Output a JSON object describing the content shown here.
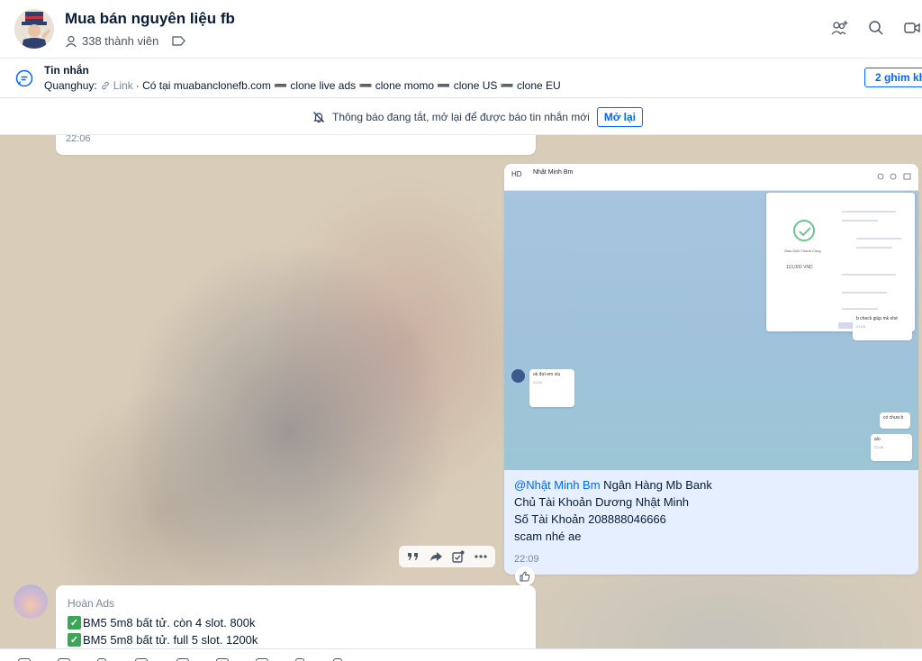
{
  "header": {
    "title": "Mua bán nguyên liệu fb",
    "members": "338 thành viên"
  },
  "pinned": {
    "title": "Tin nhắn",
    "sender": "Quanghuy:",
    "link_label": "Link",
    "text": "· Có tại muabanclonefb.com ➖ clone live ads ➖ clone momo ➖ clone US ➖ clone EU",
    "pins_button": "2 ghim khác"
  },
  "notification": {
    "text": "Thông báo đang tắt, mở lại để được báo tin nhắn mới",
    "reopen_label": "Mở lại"
  },
  "messages": {
    "previous_time": "22:06",
    "card": {
      "screenshot": {
        "initials": "HD",
        "name": "Nhật Minh Bm",
        "receipt_title": "Giao Dịch Thành Công",
        "receipt_amount": "110,000 VND",
        "msg1": "b check giúp mk nhé",
        "msg1_time": "21:03",
        "msg2": "ok đợi em xíu",
        "msg2_time": "21:04",
        "msg3": "có chưa b",
        "msg4": "alo",
        "msg4_time": "22:08"
      },
      "mention": "@Nhật Minh Bm",
      "line1_rest": " Ngân Hàng Mb Bank",
      "line2": "Chủ Tài Khoản Dương Nhật Minh",
      "line3": "Số Tài Khoản 208888046666",
      "line4": "scam nhé ae",
      "time": "22:09"
    },
    "hoan": {
      "sender": "Hoàn Ads",
      "line1": "BM5 5m8 bất tử. còn 4 slot. 800k",
      "line2": "BM5 5m8 bất tử. full 5 slot. 1200k"
    }
  },
  "colors": {
    "accent": "#0068ff",
    "own_bubble": "#e5efff",
    "text": "#081c36",
    "muted": "#7589a3"
  }
}
